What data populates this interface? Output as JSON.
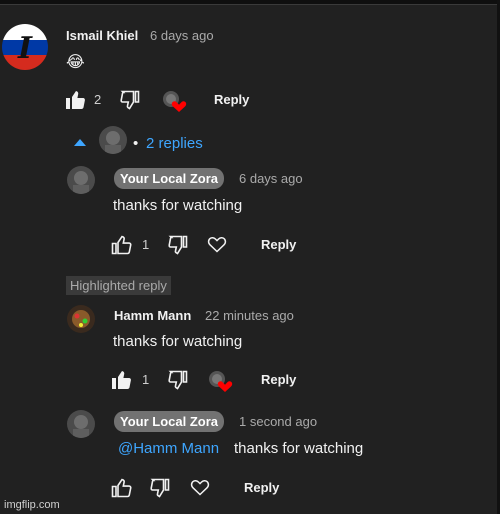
{
  "top_comment": {
    "author": "Ismail Khiel",
    "time": "6 days ago",
    "text": "😂",
    "like_count": "2",
    "reply_label": "Reply"
  },
  "replies_toggle": {
    "dot": "•",
    "label": "2 replies"
  },
  "reply1": {
    "author": "Your Local Zora",
    "time": "6 days ago",
    "text": "thanks for watching",
    "like_count": "1",
    "reply_label": "Reply"
  },
  "highlighted_label": "Highlighted reply",
  "reply2": {
    "author": "Hamm Mann",
    "time": "22 minutes ago",
    "text": "thanks for watching",
    "like_count": "1",
    "reply_label": "Reply"
  },
  "reply3": {
    "author": "Your Local Zora",
    "time": "1 second ago",
    "mention": "@Hamm Mann",
    "text": "thanks for watching",
    "reply_label": "Reply"
  },
  "watermark": "imgflip.com",
  "colors": {
    "background": "#212121",
    "link": "#3ea6ff",
    "heart": "#ff0000",
    "pill": "#727272"
  }
}
